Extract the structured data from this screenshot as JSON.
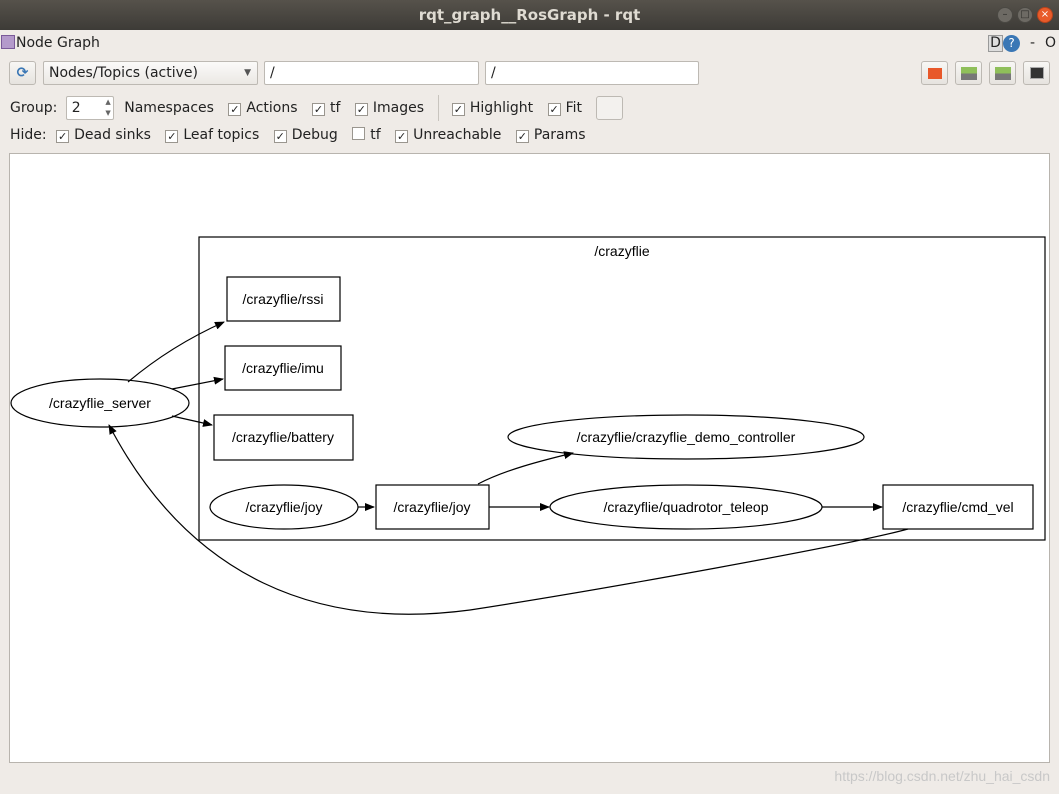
{
  "window": {
    "title": "rqt_graph__RosGraph - rqt"
  },
  "plugin": {
    "title": "Node Graph",
    "d_label": "D",
    "help": "?",
    "minus": "-",
    "o": "O"
  },
  "toolbar": {
    "mode": "Nodes/Topics (active)",
    "filter1": "/",
    "filter2": "/"
  },
  "options": {
    "group_label": "Group:",
    "group_value": "2",
    "items": [
      {
        "label": "Namespaces",
        "checked": false
      },
      {
        "label": "Actions",
        "checked": true
      },
      {
        "label": "tf",
        "checked": true
      },
      {
        "label": "Images",
        "checked": true
      },
      {
        "label": "Highlight",
        "checked": true
      },
      {
        "label": "Fit",
        "checked": true
      }
    ]
  },
  "hide": {
    "label": "Hide:",
    "items": [
      {
        "label": "Dead sinks",
        "checked": true
      },
      {
        "label": "Leaf topics",
        "checked": true
      },
      {
        "label": "Debug",
        "checked": true
      },
      {
        "label": "tf",
        "checked": false
      },
      {
        "label": "Unreachable",
        "checked": true
      },
      {
        "label": "Params",
        "checked": true
      }
    ]
  },
  "graph": {
    "cluster": "/crazyflie",
    "nodes": {
      "server": "/crazyflie_server",
      "joy_node": "/crazyflie/joy",
      "demo": "/crazyflie/crazyflie_demo_controller",
      "teleop": "/crazyflie/quadrotor_teleop"
    },
    "topics": {
      "rssi": "/crazyflie/rssi",
      "imu": "/crazyflie/imu",
      "battery": "/crazyflie/battery",
      "joy": "/crazyflie/joy",
      "cmd_vel": "/crazyflie/cmd_vel"
    }
  },
  "watermark": "https://blog.csdn.net/zhu_hai_csdn"
}
